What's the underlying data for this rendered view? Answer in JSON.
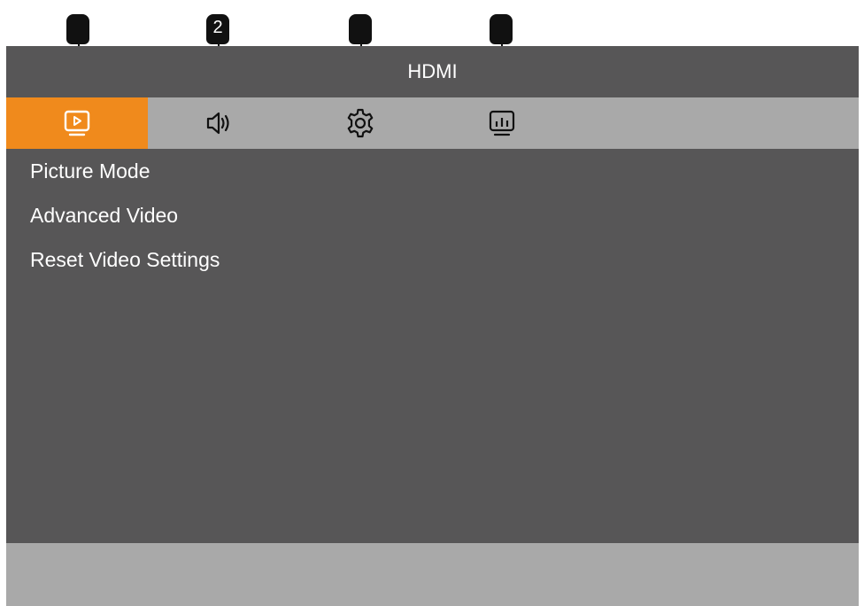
{
  "callouts": [
    {
      "label": ""
    },
    {
      "label": "2"
    },
    {
      "label": ""
    },
    {
      "label": ""
    }
  ],
  "header": {
    "title": "HDMI"
  },
  "tabs": [
    {
      "icon": "picture-icon",
      "active": true
    },
    {
      "icon": "speaker-icon",
      "active": false
    },
    {
      "icon": "gear-icon",
      "active": false
    },
    {
      "icon": "bar-chart-icon",
      "active": false
    }
  ],
  "menu": {
    "items": [
      {
        "label": "Picture Mode"
      },
      {
        "label": "Advanced Video"
      },
      {
        "label": "Reset Video Settings"
      }
    ]
  },
  "colors": {
    "accent": "#f08a1c",
    "panel": "#575657",
    "bar": "#a9a9a9",
    "callout": "#111111"
  }
}
